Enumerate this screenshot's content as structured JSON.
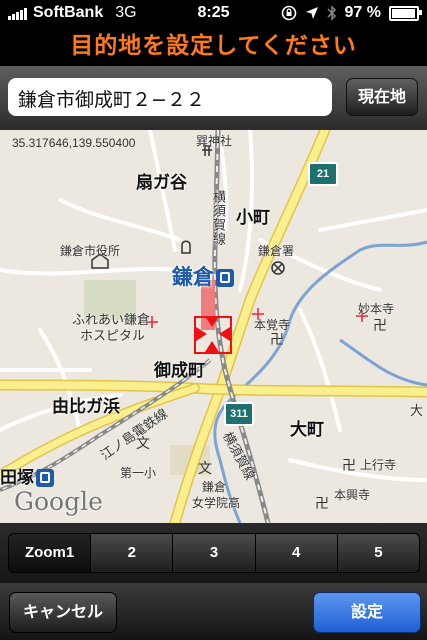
{
  "status": {
    "carrier": "SoftBank",
    "network": "3G",
    "time": "8:25",
    "battery_text": "97 %",
    "battery_level": 0.97
  },
  "title": "目的地を設定してください",
  "search": {
    "address_value": "鎌倉市御成町２−２２",
    "current_location_label": "現在地"
  },
  "map": {
    "coordinates": "35.317646,139.550400",
    "labels": {
      "ogigayatsu": "扇ガ谷",
      "komachi": "小町",
      "onarimachi": "御成町",
      "yuigahama": "由比ガ浜",
      "omachi": "大町",
      "tsukaa": "田塚",
      "yokosuka_line": "横須賀線",
      "yokosuka_line2": "横須賀線",
      "enoden": "江ノ島電鉄線"
    },
    "station": "鎌倉",
    "small_labels": {
      "kamakura_city_hall": "鎌倉市役所",
      "hospital_line1": "ふれあい鎌倉",
      "hospital_line2": "ホスピタル",
      "kamakura_police": "鎌倉署",
      "hongakuji": "本覚寺",
      "myohonji": "妙本寺",
      "daiichi_jhs": "第一小",
      "girls_hs_line1": "鎌倉",
      "girls_hs_line2": "女学院高",
      "jogyoji": "上行寺",
      "hongoji": "本興寺",
      "shrine": "巽神社",
      "edge_label": "大"
    },
    "routes": [
      "21",
      "311"
    ],
    "google_logo": "Google"
  },
  "zoom": {
    "options": [
      "Zoom1",
      "2",
      "3",
      "4",
      "5"
    ],
    "selected": "Zoom1"
  },
  "actions": {
    "cancel_label": "キャンセル",
    "set_label": "設定"
  }
}
